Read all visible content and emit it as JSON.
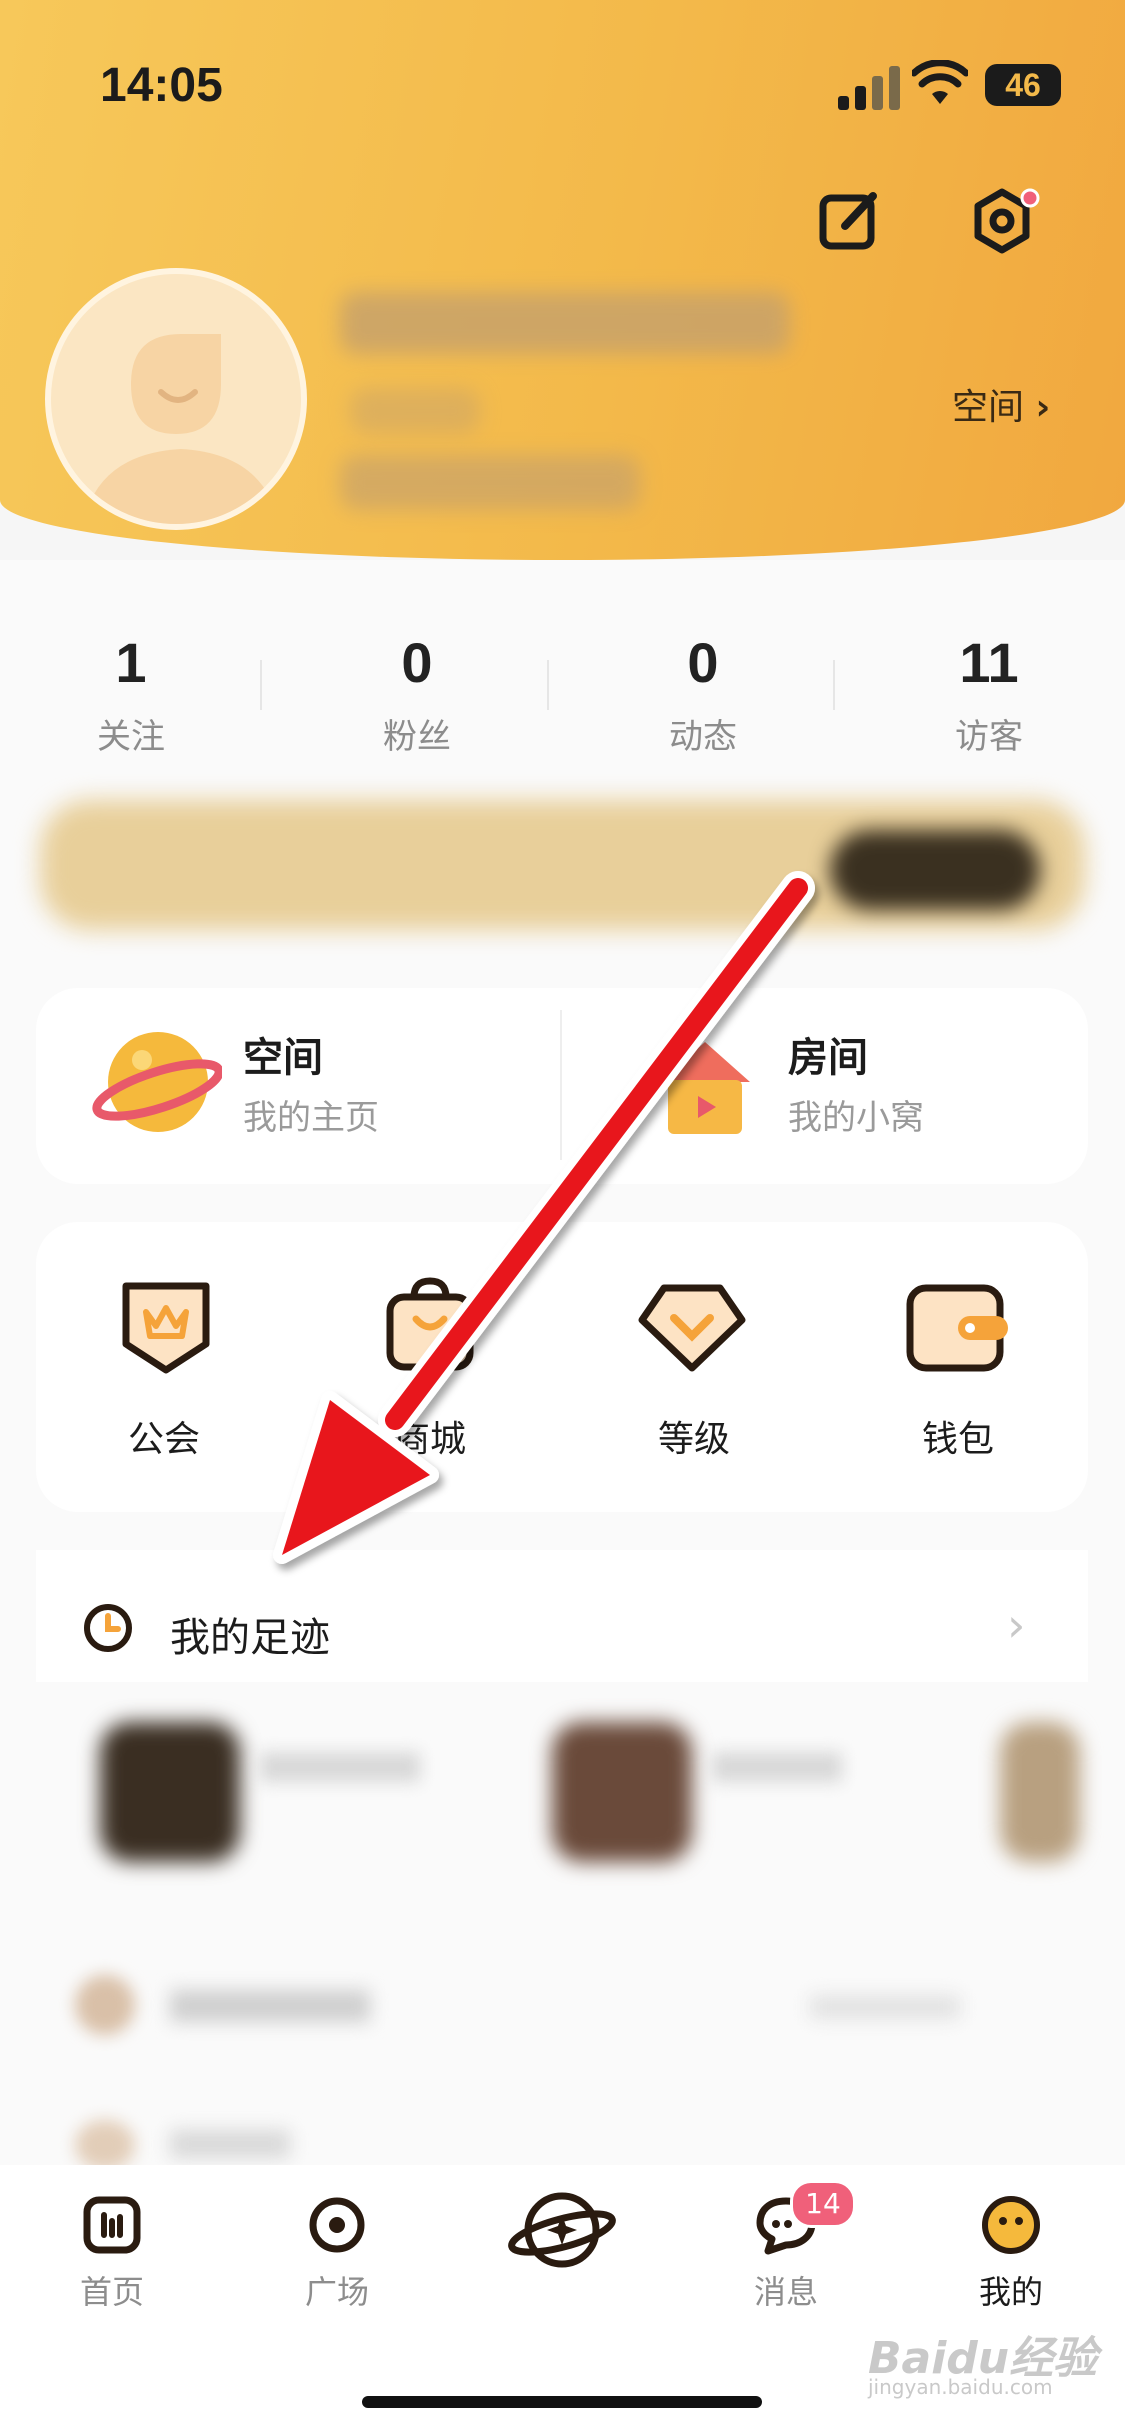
{
  "status_bar": {
    "time": "14:05",
    "battery": "46"
  },
  "profile": {
    "space_link_label": "空间"
  },
  "stats": [
    {
      "value": "1",
      "label": "关注"
    },
    {
      "value": "0",
      "label": "粉丝"
    },
    {
      "value": "0",
      "label": "动态"
    },
    {
      "value": "11",
      "label": "访客"
    }
  ],
  "feature_cards": {
    "space": {
      "title": "空间",
      "subtitle": "我的主页"
    },
    "room": {
      "title": "房间",
      "subtitle": "我的小窝"
    }
  },
  "grid": [
    {
      "label": "公会",
      "icon": "guild-crown-icon"
    },
    {
      "label": "商城",
      "icon": "shopping-bag-icon"
    },
    {
      "label": "等级",
      "icon": "level-gem-icon"
    },
    {
      "label": "钱包",
      "icon": "wallet-icon"
    }
  ],
  "footprint": {
    "title": "我的足迹"
  },
  "tabbar": [
    {
      "label": "首页",
      "icon": "home-icon"
    },
    {
      "label": "广场",
      "icon": "plaza-icon"
    },
    {
      "label": "",
      "icon": "planet-center-icon"
    },
    {
      "label": "消息",
      "icon": "message-icon"
    },
    {
      "label": "我的",
      "icon": "me-icon"
    }
  ],
  "message_badge": "14",
  "watermark": {
    "brand": "Baidu经验",
    "url": "jingyan.baidu.com"
  },
  "colors": {
    "accent": "#f3b94a",
    "badge": "#f0607a",
    "arrow": "#e8141b"
  }
}
